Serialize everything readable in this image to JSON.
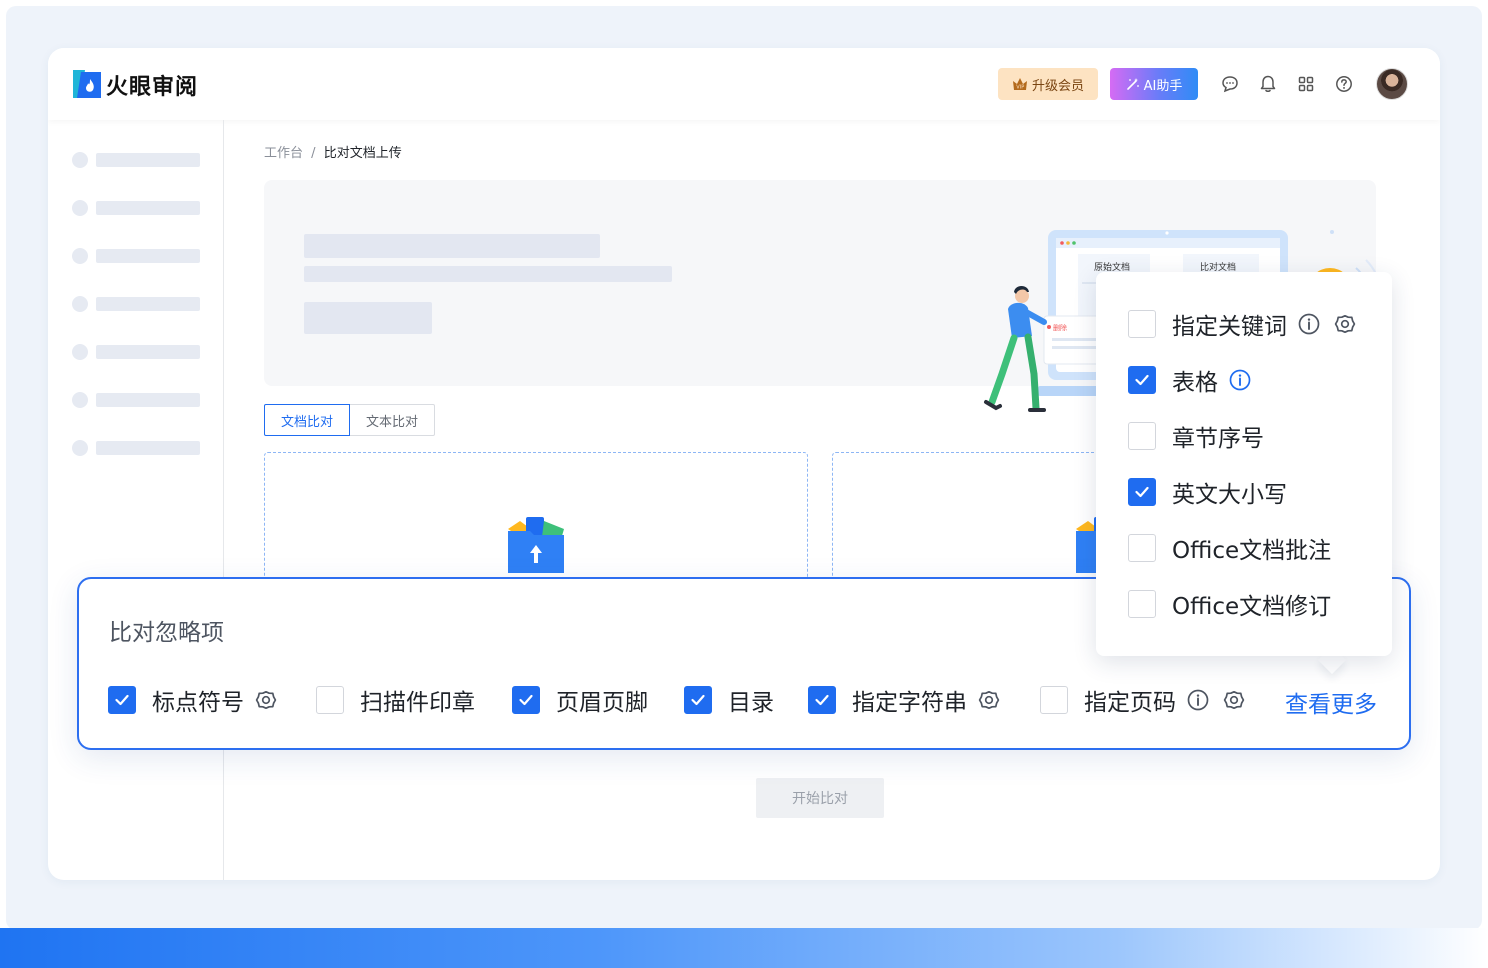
{
  "brand": {
    "name": "火眼审阅"
  },
  "header": {
    "vip_label": "升级会员",
    "ai_label": "AI助手",
    "icons": [
      "message-icon",
      "bell-icon",
      "apps-grid-icon",
      "help-icon"
    ]
  },
  "breadcrumb": {
    "root": "工作台",
    "separator": "/",
    "current": "比对文档上传"
  },
  "illustration": {
    "left_doc_label": "原始文档",
    "right_doc_label": "比对文档",
    "delete_tag": "删除"
  },
  "tabs": [
    {
      "label": "文档比对",
      "active": true
    },
    {
      "label": "文本比对",
      "active": false
    }
  ],
  "start_button": {
    "label": "开始比对",
    "disabled": true
  },
  "ignore_panel": {
    "title": "比对忽略项",
    "options": [
      {
        "label": "标点符号",
        "checked": true,
        "settings": true,
        "info": false
      },
      {
        "label": "扫描件印章",
        "checked": false,
        "settings": false,
        "info": false
      },
      {
        "label": "页眉页脚",
        "checked": true,
        "settings": false,
        "info": false
      },
      {
        "label": "目录",
        "checked": true,
        "settings": false,
        "info": false
      },
      {
        "label": "指定字符串",
        "checked": true,
        "settings": true,
        "info": false
      },
      {
        "label": "指定页码",
        "checked": false,
        "settings": true,
        "info": true
      }
    ],
    "more_label": "查看更多"
  },
  "more_popup": {
    "options": [
      {
        "label": "指定关键词",
        "checked": false,
        "info": true,
        "settings": true
      },
      {
        "label": "表格",
        "checked": true,
        "info": true,
        "settings": false
      },
      {
        "label": "章节序号",
        "checked": false,
        "info": false,
        "settings": false
      },
      {
        "label": "英文大小写",
        "checked": true,
        "info": false,
        "settings": false
      },
      {
        "label": "Office文档批注",
        "checked": false,
        "info": false,
        "settings": false
      },
      {
        "label": "Office文档修订",
        "checked": false,
        "info": false,
        "settings": false
      }
    ]
  },
  "colors": {
    "primary": "#1f6cf0",
    "vip_bg": "#fde3c2",
    "vip_text": "#7a4512",
    "accent_yellow": "#ffb81f"
  }
}
